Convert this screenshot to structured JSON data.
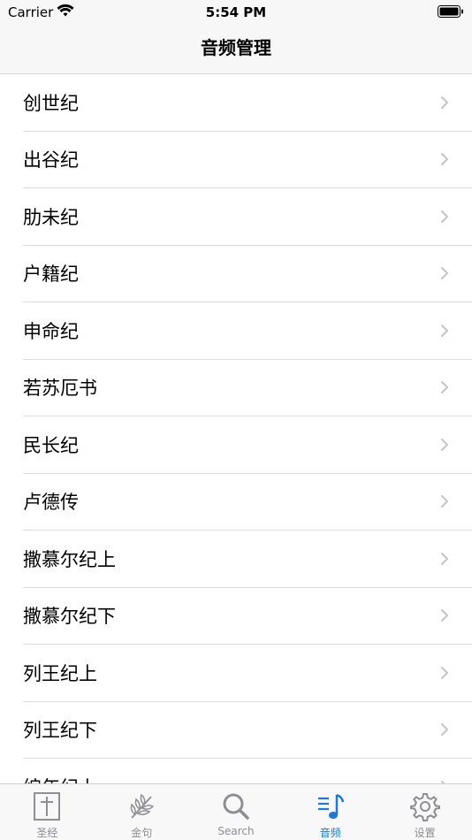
{
  "status_bar": {
    "carrier": "Carrier",
    "time": "5:54 PM"
  },
  "nav": {
    "title": "音频管理"
  },
  "books": [
    {
      "name": "创世纪"
    },
    {
      "name": "出谷纪"
    },
    {
      "name": "肋未纪"
    },
    {
      "name": "户籍纪"
    },
    {
      "name": "申命纪"
    },
    {
      "name": "若苏厄书"
    },
    {
      "name": "民长纪"
    },
    {
      "name": "卢德传"
    },
    {
      "name": "撒慕尔纪上"
    },
    {
      "name": "撒慕尔纪下"
    },
    {
      "name": "列王纪上"
    },
    {
      "name": "列王纪下"
    },
    {
      "name": "编年纪上"
    }
  ],
  "tabs": [
    {
      "label": "圣经",
      "icon": "bible-cross-icon"
    },
    {
      "label": "金句",
      "icon": "olive-branch-icon"
    },
    {
      "label": "Search",
      "icon": "search-icon"
    },
    {
      "label": "音频",
      "icon": "music-note-icon",
      "active": true
    },
    {
      "label": "设置",
      "icon": "gear-icon"
    }
  ],
  "colors": {
    "accent": "#1f78d6",
    "inactive": "#8e8e93"
  }
}
